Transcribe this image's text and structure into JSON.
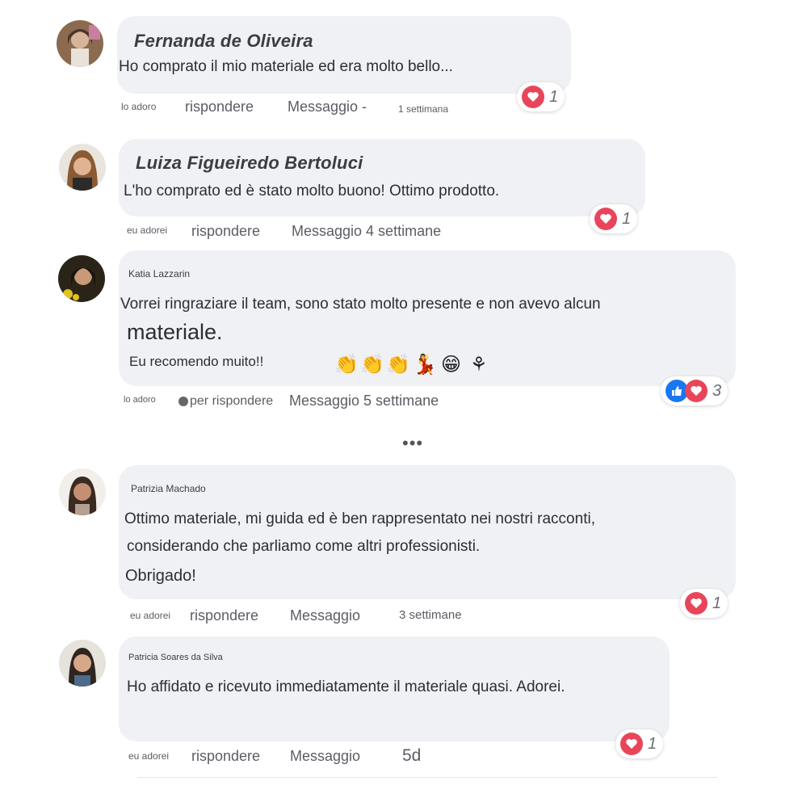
{
  "comments": [
    {
      "author": "Fernanda de Oliveira",
      "lines": [
        "Ho comprato il mio materiale ed era molto bello..."
      ],
      "actions": {
        "like": "lo adoro",
        "reply": "rispondere",
        "message": "Messaggio -",
        "time": "1 settimana"
      },
      "reactions": {
        "count": "1"
      }
    },
    {
      "author": "Luiza Figueiredo Bertoluci",
      "lines": [
        "L'ho comprato ed è stato molto buono! Ottimo prodotto."
      ],
      "actions": {
        "like": "eu adorei",
        "reply": "rispondere",
        "message": "Messaggio 4 settimane"
      },
      "reactions": {
        "count": "1"
      }
    },
    {
      "author": "Katia Lazzarin",
      "lines": [
        "Vorrei ringraziare il team, sono stato molto presente e non avevo alcun",
        "materiale.",
        "Eu recomendo muito!!"
      ],
      "emojis": [
        "👏",
        "👏",
        "👏",
        "💃",
        "😁",
        "⚘"
      ],
      "actions": {
        "like": "lo adoro",
        "reply": "per rispondere",
        "message": "Messaggio 5 settimane"
      },
      "reactions": {
        "count": "3"
      }
    },
    {
      "author": "Patrizia Machado",
      "lines": [
        "Ottimo materiale, mi guida ed è ben rappresentato nei nostri racconti,",
        "considerando che parliamo come altri professionisti.",
        "Obrigado!"
      ],
      "actions": {
        "like": "eu adorei",
        "reply": "rispondere",
        "message": "Messaggio",
        "time": "3 settimane"
      },
      "reactions": {
        "count": "1"
      }
    },
    {
      "author": "Patricia Soares da Silva",
      "lines": [
        "Ho affidato e ricevuto immediatamente il materiale quasi. Adorei."
      ],
      "actions": {
        "like": "eu adorei",
        "reply": "rispondere",
        "message": "Messaggio",
        "time": "5d"
      },
      "reactions": {
        "count": "1"
      }
    }
  ],
  "more": "•••",
  "icons": {
    "reaction_love": "heart-icon",
    "reaction_like": "thumbs-up-icon"
  },
  "colors": {
    "bubble": "#f0f1f4",
    "love": "#e8455b",
    "like": "#1877f2"
  }
}
